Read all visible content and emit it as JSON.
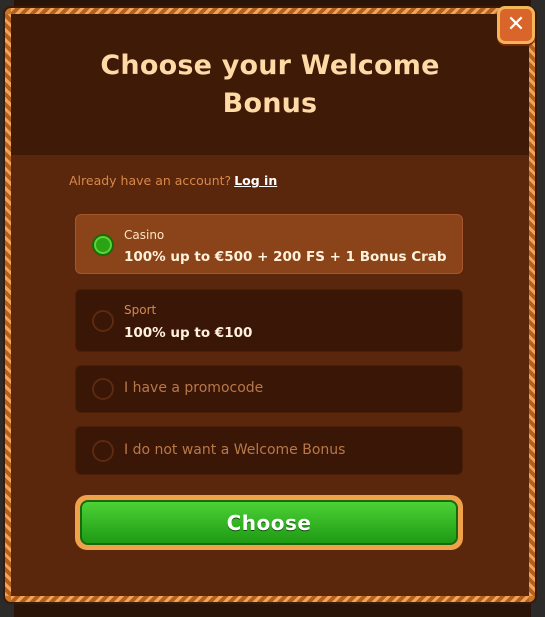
{
  "modal": {
    "title": "Choose your Welcome Bonus",
    "close_icon": "close-icon",
    "login_prompt": "Already have an account?",
    "login_link": "Log in"
  },
  "options": [
    {
      "small": "Casino",
      "main": "100% up to €500 + 200 FS + 1 Bonus Crab",
      "selected": true
    },
    {
      "small": "Sport",
      "main": "100% up to €100",
      "selected": false
    },
    {
      "label": "I have a promocode",
      "selected": false
    },
    {
      "label": "I do not want a Welcome Bonus",
      "selected": false
    }
  ],
  "cta": {
    "label": "Choose"
  },
  "colors": {
    "accent": "#c9782a",
    "primary_button": "#2aa414",
    "selected_option": "#8b4419"
  }
}
